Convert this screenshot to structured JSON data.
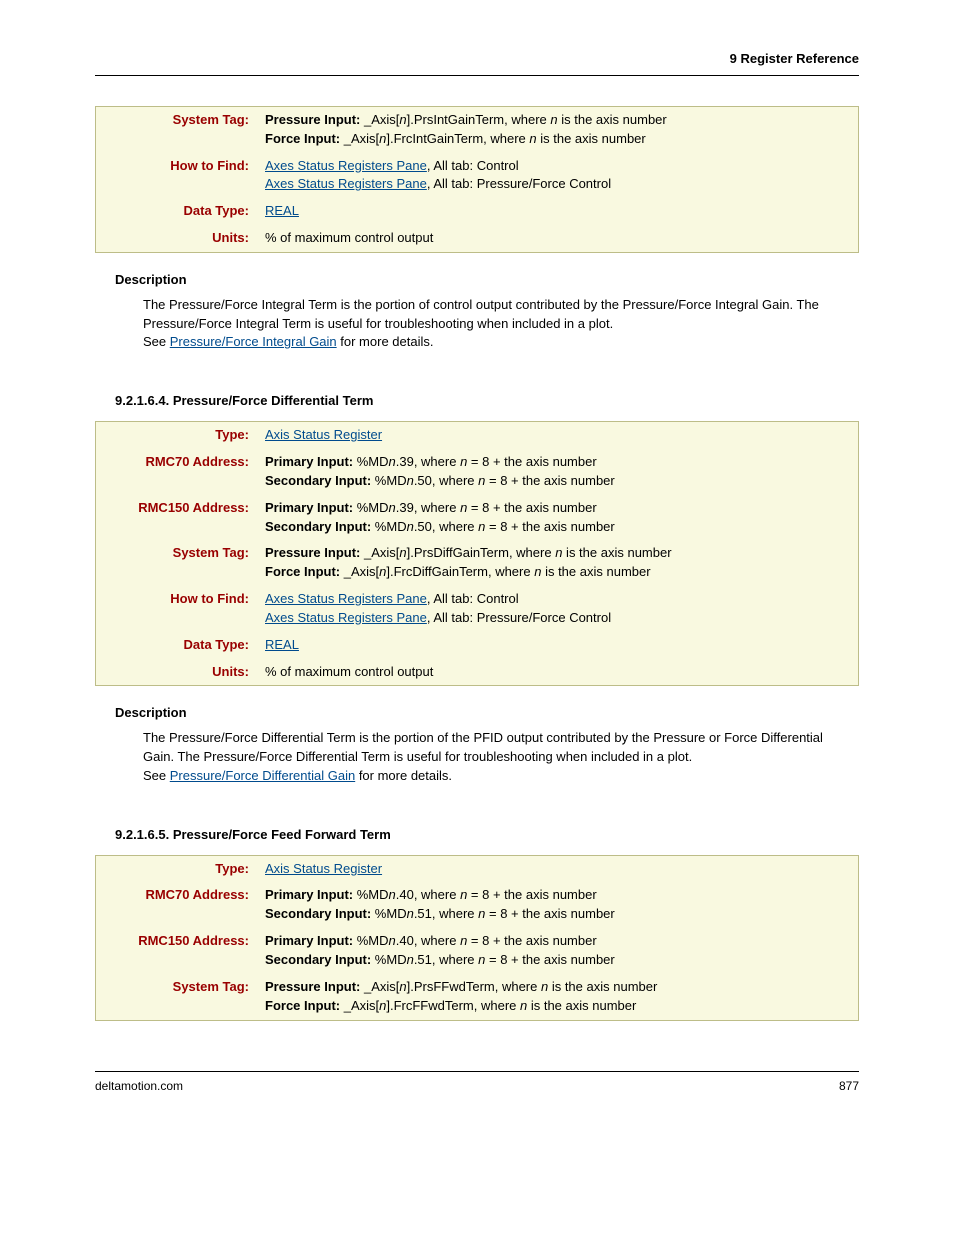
{
  "header": "9  Register Reference",
  "footer": {
    "left": "deltamotion.com",
    "right": "877"
  },
  "table1": {
    "rows": [
      {
        "label": "System Tag:",
        "html": "<b>Pressure Input:</b>  _Axis[<i>n</i>].PrsIntGainTerm, where <i>n</i> is the axis number<br><b>Force Input:</b>  _Axis[<i>n</i>].FrcIntGainTerm, where <i>n</i> is the axis number"
      },
      {
        "label": "How to Find:",
        "html": "<a class='link' href='#'>Axes Status Registers Pane</a>, All tab: Control<br><a class='link' href='#'>Axes Status Registers Pane</a>, All tab: Pressure/Force Control"
      },
      {
        "label": "Data Type:",
        "html": "<a class='link' href='#'>REAL</a>"
      },
      {
        "label": "Units:",
        "html": "% of maximum control output"
      }
    ]
  },
  "desc1": {
    "heading": "Description",
    "body": "The Pressure/Force Integral Term is the portion of control output contributed by the Pressure/Force Integral Gain. The Pressure/Force Integral Term is useful for troubleshooting when included in a plot.<br>See <a class='link' href='#'>Pressure/Force Integral Gain</a> for more details."
  },
  "section2": {
    "heading": "9.2.1.6.4. Pressure/Force Differential Term",
    "rows": [
      {
        "label": "Type:",
        "html": "<a class='link' href='#'>Axis Status Register</a>"
      },
      {
        "label": "RMC70 Address:",
        "html": "<b>Primary Input:</b> %MD<i>n</i>.39, where <i>n</i> = 8 + the axis number<br><b>Secondary Input:</b> %MD<i>n</i>.50, where <i>n</i> = 8 + the axis number"
      },
      {
        "label": "RMC150 Address:",
        "html": "<b>Primary Input:</b> %MD<i>n</i>.39, where <i>n</i> = 8 + the axis number<br><b>Secondary Input:</b> %MD<i>n</i>.50, where <i>n</i> = 8 + the axis number"
      },
      {
        "label": "System Tag:",
        "html": "<b>Pressure Input:</b>  _Axis[<i>n</i>].PrsDiffGainTerm, where <i>n</i> is the axis number<br><b>Force Input:</b>  _Axis[<i>n</i>].FrcDiffGainTerm, where <i>n</i> is the axis number"
      },
      {
        "label": "How to Find:",
        "html": "<a class='link' href='#'>Axes Status Registers Pane</a>, All tab: Control<br><a class='link' href='#'>Axes Status Registers Pane</a>, All tab: Pressure/Force Control"
      },
      {
        "label": "Data Type:",
        "html": "<a class='link' href='#'>REAL</a>"
      },
      {
        "label": "Units:",
        "html": "% of maximum control output"
      }
    ],
    "descHeading": "Description",
    "descBody": "The Pressure/Force Differential Term is the portion of the PFID output contributed by the Pressure or Force Differential Gain. The Pressure/Force Differential Term is useful for troubleshooting when included in a plot.<br>See <a class='link' href='#'>Pressure/Force Differential Gain</a> for more details."
  },
  "section3": {
    "heading": "9.2.1.6.5. Pressure/Force Feed Forward Term",
    "rows": [
      {
        "label": "Type:",
        "html": "<a class='link' href='#'>Axis Status Register</a>"
      },
      {
        "label": "RMC70 Address:",
        "html": "<b>Primary Input:</b> %MD<i>n</i>.40, where <i>n</i> = 8 + the axis number<br><b>Secondary Input:</b> %MD<i>n</i>.51, where <i>n</i> = 8 + the axis number"
      },
      {
        "label": "RMC150 Address:",
        "html": "<b>Primary Input:</b> %MD<i>n</i>.40, where <i>n</i> = 8 + the axis number<br><b>Secondary Input:</b> %MD<i>n</i>.51, where <i>n</i> = 8 + the axis number"
      },
      {
        "label": "System Tag:",
        "html": "<b>Pressure Input:</b>  _Axis[<i>n</i>].PrsFFwdTerm, where <i>n</i> is the axis number<br><b>Force Input:</b>  _Axis[<i>n</i>].FrcFFwdTerm, where <i>n</i> is the axis number"
      }
    ]
  }
}
